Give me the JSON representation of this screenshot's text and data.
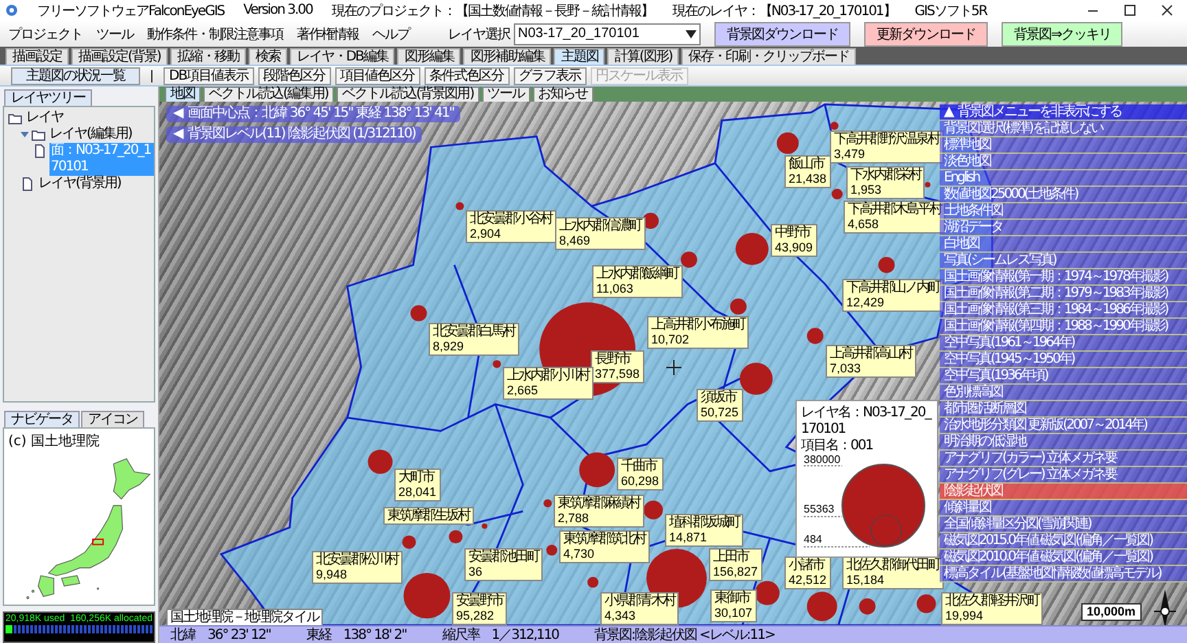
{
  "title_bar": {
    "app": "フリーソフトウェアFalconEyeGIS",
    "version": "Version 3.00",
    "project": "現在のプロジェクト：【国土数値情報－長野－統計情報】",
    "layer": "現在のレイヤ：【N03-17_20_170101】",
    "extra": "GISソフト5R"
  },
  "menus": [
    "プロジェクト",
    "ツール",
    "動作条件・制限注意事項",
    "著作権情報",
    "ヘルプ"
  ],
  "layer_select": {
    "label": "レイヤ選択",
    "value": "N03-17_20_170101"
  },
  "buttons": [
    {
      "label": "背景図ダウンロード",
      "color": "#c8c8ff"
    },
    {
      "label": "更新ダウンロード",
      "color": "#ffc0c0"
    },
    {
      "label": "背景図⇒クッキリ",
      "color": "#c0ffc0"
    }
  ],
  "tabs": [
    {
      "label": "描画設定",
      "selected": false
    },
    {
      "label": "描画設定(背景)",
      "selected": false
    },
    {
      "label": "拡縮・移動",
      "selected": false
    },
    {
      "label": "検索",
      "selected": false
    },
    {
      "label": "レイヤ・DB編集",
      "selected": false
    },
    {
      "label": "図形編集",
      "selected": false
    },
    {
      "label": "図形補助編集",
      "selected": false
    },
    {
      "label": "主題図",
      "selected": true
    },
    {
      "label": "計算(図形)",
      "selected": false
    },
    {
      "label": "保存・印刷・クリップボード",
      "selected": false
    }
  ],
  "toolbar": [
    {
      "label": "主題図の状況一覧",
      "disabled": false
    },
    {
      "label": "DB項目値表示",
      "disabled": false
    },
    {
      "label": "段階色区分",
      "disabled": false
    },
    {
      "label": "項目値色区分",
      "disabled": false
    },
    {
      "label": "条件式色区分",
      "disabled": false
    },
    {
      "label": "グラフ表示",
      "disabled": false
    },
    {
      "label": "円スケール表示",
      "disabled": true
    }
  ],
  "layer_panel": {
    "tab": "レイヤツリー",
    "tree": [
      {
        "label": "レイヤ",
        "kind": "folder",
        "selected": false,
        "children": [
          {
            "label": "レイヤ(編集用)",
            "kind": "folder",
            "selected": false,
            "children": [
              {
                "label": "面：N03-17_20_170101",
                "kind": "file",
                "selected": true
              }
            ]
          },
          {
            "label": "レイヤ(背景用)",
            "kind": "file",
            "selected": false
          }
        ]
      }
    ]
  },
  "navigator": {
    "tabs": [
      {
        "label": "ナビゲータ",
        "selected": true
      },
      {
        "label": "アイコン",
        "selected": false
      }
    ],
    "caption": "(c) 国土地理院"
  },
  "memory": {
    "used": "20,918K used",
    "allocated": "160,256K allocated",
    "level": 0.05
  },
  "map_tabs": [
    {
      "label": "地図",
      "selected": true
    },
    {
      "label": "ベクトル読込(編集用)",
      "selected": false
    },
    {
      "label": "ベクトル読込(背景図用)",
      "selected": false
    },
    {
      "label": "ツール",
      "selected": false
    },
    {
      "label": "お知らせ",
      "selected": false
    }
  ],
  "map": {
    "info_buttons": [
      {
        "icon": "◀",
        "label": "画面中心点：北緯 36° 45' 15\" 東経 138° 13' 41\""
      },
      {
        "icon": "◀",
        "label": "背景図レベル(11) 陰影起伏図 (1/312110)"
      }
    ],
    "places": [
      {
        "name": "下高井郡野沢温泉村",
        "value": "3,479"
      },
      {
        "name": "飯山市",
        "value": "21,438"
      },
      {
        "name": "下水内郡栄村",
        "value": "1,953"
      },
      {
        "name": "北安曇郡小谷村",
        "value": "2,904"
      },
      {
        "name": "下高井郡木島平村",
        "value": "4,658"
      },
      {
        "name": "上水内郡信濃町",
        "value": "8,469"
      },
      {
        "name": "中野市",
        "value": "43,909"
      },
      {
        "name": "上水内郡飯綱町",
        "value": "11,063"
      },
      {
        "name": "下高井郡山ノ内町",
        "value": "12,429"
      },
      {
        "name": "北安曇郡白馬村",
        "value": "8,929"
      },
      {
        "name": "上高井郡小布施町",
        "value": "10,702"
      },
      {
        "name": "長野市",
        "value": "377,598"
      },
      {
        "name": "上高井郡高山村",
        "value": "7,033"
      },
      {
        "name": "上水内郡小川村",
        "value": "2,665"
      },
      {
        "name": "須坂市",
        "value": "50,725"
      },
      {
        "name": "大町市",
        "value": "28,041"
      },
      {
        "name": "千曲市",
        "value": "60,298"
      },
      {
        "name": "東筑摩郡生坂村"
      },
      {
        "name": "東筑摩郡麻績村",
        "value": "2,788"
      },
      {
        "name": "埴科郡坂城町",
        "value": "14,871"
      },
      {
        "name": "東筑摩郡筑北村",
        "value": "4,730"
      },
      {
        "name": "北安曇郡松川村",
        "value": "9,948"
      },
      {
        "name": "安曇郡池田町",
        "value": "36"
      },
      {
        "name": "上田市",
        "value": "156,827"
      },
      {
        "name": "小諸市",
        "value": "42,512"
      },
      {
        "name": "北佐久郡御代田町",
        "value": "15,184"
      },
      {
        "name": "安曇野市",
        "value": "95,282"
      },
      {
        "name": "小県郡青木村",
        "value": "4,343"
      },
      {
        "name": "東御市",
        "value": "30,107"
      },
      {
        "name": "北佐久郡軽井沢町",
        "value": "19,994"
      }
    ],
    "legend": {
      "layer": "レイヤ名：N03-17_20_170101",
      "field": "項目名：001",
      "max": "380000",
      "mid": "55363",
      "min": "484"
    },
    "attribution": "国土地理院－地理院タイル",
    "scale": "10,000m"
  },
  "background_menu": {
    "toggle_icon": "▲",
    "toggle": "背景図メニューを非表示にする",
    "items": [
      {
        "label": "背景図選択(標準)を記憶しない",
        "selected": false
      },
      {
        "label": "標準地図",
        "selected": false
      },
      {
        "label": "淡色地図",
        "selected": false
      },
      {
        "label": "English",
        "selected": false
      },
      {
        "label": "数値地図25000(土地条件)",
        "selected": false
      },
      {
        "label": "土地条件図",
        "selected": false
      },
      {
        "label": "湖沼データ",
        "selected": false
      },
      {
        "label": "白地図",
        "selected": false
      },
      {
        "label": "写真(シームレス写真)",
        "selected": false
      },
      {
        "label": "国土画像情報(第一期：1974～1978年撮影)",
        "selected": false
      },
      {
        "label": "国土画像情報(第二期：1979～1983年撮影)",
        "selected": false
      },
      {
        "label": "国土画像情報(第三期：1984～1986年撮影)",
        "selected": false
      },
      {
        "label": "国土画像情報(第四期：1988～1990年撮影)",
        "selected": false
      },
      {
        "label": "空中写真(1961～1964年)",
        "selected": false
      },
      {
        "label": "空中写真(1945～1950年)",
        "selected": false
      },
      {
        "label": "空中写真(1936年頃)",
        "selected": false
      },
      {
        "label": "色別標高図",
        "selected": false
      },
      {
        "label": "都市圏活断層図",
        "selected": false
      },
      {
        "label": "治水地形分類図 更新版(2007～2014年)",
        "selected": false
      },
      {
        "label": "明治期の低湿地",
        "selected": false
      },
      {
        "label": "アナグリフ(カラー) 立体メガネ要",
        "selected": false
      },
      {
        "label": "アナグリフ(グレー) 立体メガネ要",
        "selected": false
      },
      {
        "label": "陰影起伏図",
        "selected": true
      },
      {
        "label": "傾斜量図",
        "selected": false
      },
      {
        "label": "全国傾斜量区分図(雪崩関連)",
        "selected": false
      },
      {
        "label": "磁気図2015.0年値 磁気図(偏角／一覧図)",
        "selected": false
      },
      {
        "label": "磁気図2010.0年値 磁気図(偏角／一覧図)",
        "selected": false
      },
      {
        "label": "標高タイル(基盤地図情報数値標高モデル)",
        "selected": false
      }
    ]
  },
  "status_bar": [
    "北緯　36° 23' 12\"",
    "東経　138° 18' 2\"",
    "縮尺率　1／312,110",
    "背景図:陰影起伏図 <レベル:11>"
  ]
}
